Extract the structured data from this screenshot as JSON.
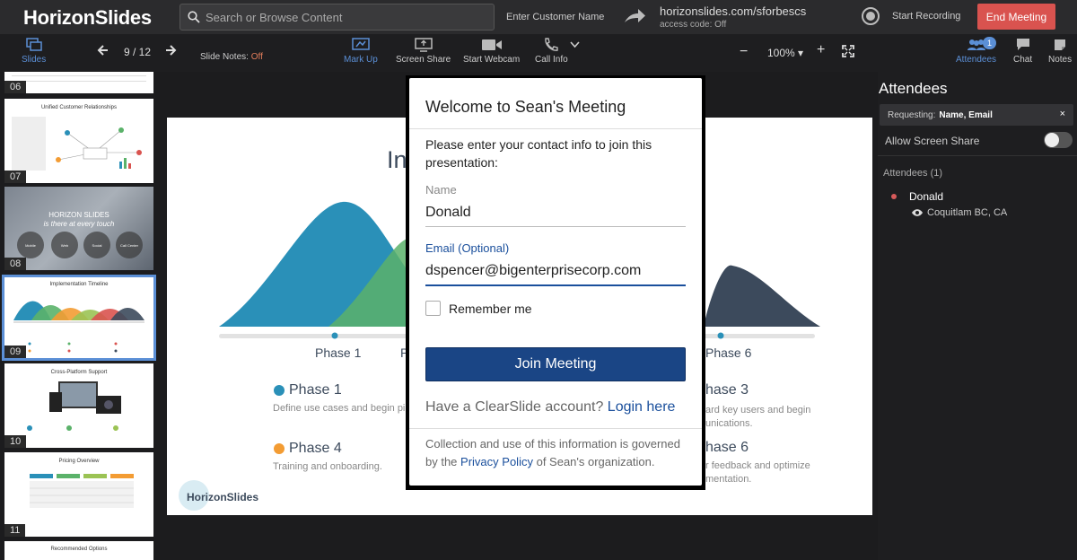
{
  "app": {
    "logo_bold": "Horizon",
    "logo_rest": "Slides",
    "search_placeholder": "Search or Browse Content",
    "customer_name_label": "Enter Customer Name",
    "meeting_url": "horizonslides.com/sforbescs",
    "access_code": "access code: Off",
    "record_label": "Start Recording",
    "end_meeting_label": "End Meeting"
  },
  "toolbar": {
    "slides_label": "Slides",
    "slide_counter": "9 / 12",
    "slide_notes_label": "Slide Notes:",
    "slide_notes_value": "Off",
    "markup_label": "Mark Up",
    "screenshare_label": "Screen Share",
    "webcam_label": "Start Webcam",
    "callinfo_label": "Call Info",
    "zoom_value": "100% ▾",
    "attendees_label": "Attendees",
    "attendees_badge": "1",
    "chat_label": "Chat",
    "notes_label": "Notes"
  },
  "thumbnails": [
    {
      "num": "06"
    },
    {
      "num": "07",
      "title": "Unified Customer Relationships"
    },
    {
      "num": "08",
      "title": "HORIZON SLIDES",
      "subtitle": "is there at every touch",
      "circles": [
        "Mobile",
        "Web",
        "Social",
        "Call Center"
      ]
    },
    {
      "num": "09",
      "title": "Implementation Timeline"
    },
    {
      "num": "10",
      "title": "Cross-Platform Support"
    },
    {
      "num": "11",
      "title": "Pricing Overview"
    },
    {
      "num": "",
      "title": "Recommended Options"
    }
  ],
  "slide": {
    "title_fragment": "In",
    "phase1_label": "Phase 1",
    "phase_partial_label": "P",
    "phase6_label": "Phase 6",
    "phase1_head": "Phase 1",
    "phase1_desc": "Define use cases and begin pilo",
    "phase4_head": "Phase 4",
    "phase4_desc": "Training and onboarding.",
    "phase3_head": "hase 3",
    "phase3_desc_1": "ard key users and begin",
    "phase3_desc_2": "unications.",
    "phase6_head": "hase 6",
    "phase6_desc_1": "r feedback and optimize",
    "phase6_desc_2": "mentation.",
    "logo": "HorizonSlides",
    "colors": {
      "teal": "#2a90b8",
      "green": "#5bb26a",
      "orange": "#f39c33",
      "dark": "#3c4a5c"
    }
  },
  "modal": {
    "title": "Welcome to Sean's Meeting",
    "intro": "Please enter your contact info to join this presentation:",
    "name_label": "Name",
    "name_value": "Donald",
    "email_label": "Email (Optional)",
    "email_value": "dspencer@bigenterprisecorp.com",
    "remember_label": "Remember me",
    "join_label": "Join Meeting",
    "account_prefix": "Have a ClearSlide account?",
    "login_link": "Login here",
    "legal_prefix": "Collection and use of this information is governed by the",
    "privacy_link": "Privacy Policy",
    "legal_suffix": "of Sean's organization."
  },
  "panel": {
    "title": "Attendees",
    "requesting_label": "Requesting:",
    "requesting_value": "Name, Email",
    "close": "×",
    "screen_share_label": "Allow Screen Share",
    "attendees_count": "Attendees (1)",
    "attendee_name": "Donald",
    "attendee_location": "Coquitlam BC, CA"
  }
}
